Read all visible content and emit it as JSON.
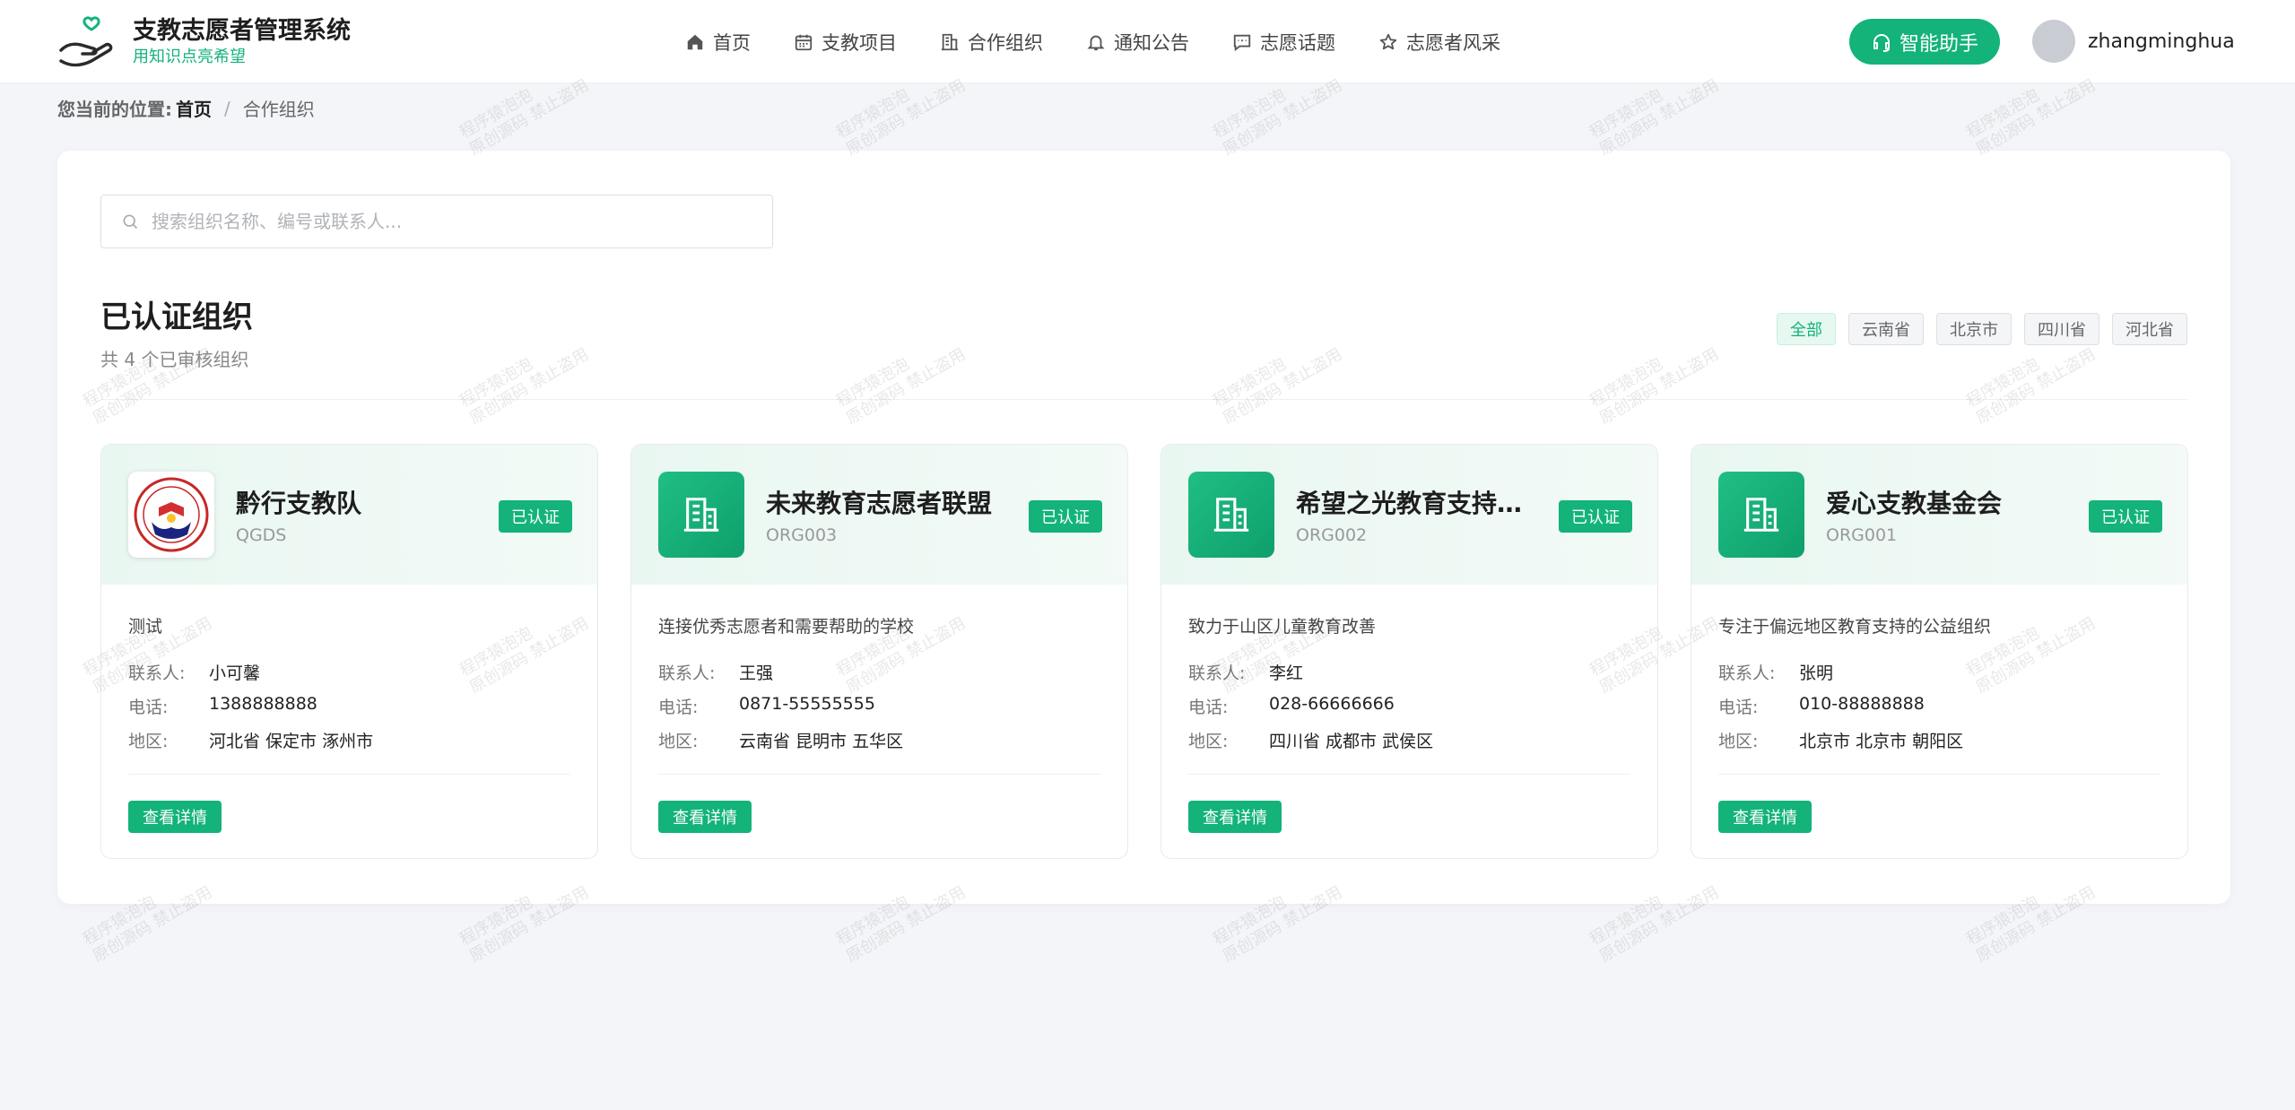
{
  "brand": {
    "title": "支教志愿者管理系统",
    "slogan": "用知识点亮希望",
    "accent": "#13b37a"
  },
  "nav": [
    {
      "label": "首页",
      "icon": "home-icon"
    },
    {
      "label": "支教项目",
      "icon": "calendar-icon"
    },
    {
      "label": "合作组织",
      "icon": "building-icon"
    },
    {
      "label": "通知公告",
      "icon": "bell-icon"
    },
    {
      "label": "志愿话题",
      "icon": "chat-icon"
    },
    {
      "label": "志愿者风采",
      "icon": "star-icon"
    }
  ],
  "assistant": {
    "label": "智能助手",
    "icon": "headset-icon"
  },
  "user": {
    "name": "zhangminghua"
  },
  "breadcrumb": {
    "prefix": "您当前的位置:",
    "home": "首页",
    "separator": "/",
    "current": "合作组织"
  },
  "search": {
    "placeholder": "搜索组织名称、编号或联系人..."
  },
  "section": {
    "title": "已认证组织",
    "subtitle": "共 4 个已审核组织"
  },
  "filters": [
    "全部",
    "云南省",
    "北京市",
    "四川省",
    "河北省"
  ],
  "labels": {
    "contact": "联系人:",
    "phone": "电话:",
    "region": "地区:",
    "detail_button": "查看详情",
    "verified": "已认证"
  },
  "orgs": [
    {
      "name": "黔行支教队",
      "code": "QGDS",
      "desc": "测试",
      "contact": "小可馨",
      "phone": "1388888888",
      "region": "河北省 保定市 涿州市",
      "logo": "emblem-image"
    },
    {
      "name": "未来教育志愿者联盟",
      "code": "ORG003",
      "desc": "连接优秀志愿者和需要帮助的学校",
      "contact": "王强",
      "phone": "0871-55555555",
      "region": "云南省 昆明市 五华区",
      "logo": "building-icon"
    },
    {
      "name": "希望之光教育支持…",
      "code": "ORG002",
      "desc": "致力于山区儿童教育改善",
      "contact": "李红",
      "phone": "028-66666666",
      "region": "四川省 成都市 武侯区",
      "logo": "building-icon"
    },
    {
      "name": "爱心支教基金会",
      "code": "ORG001",
      "desc": "专注于偏远地区教育支持的公益组织",
      "contact": "张明",
      "phone": "010-88888888",
      "region": "北京市 北京市 朝阳区",
      "logo": "building-icon"
    }
  ],
  "watermark": {
    "line1": "程序猿泡泡",
    "line2": "原创源码 禁止盗用"
  }
}
